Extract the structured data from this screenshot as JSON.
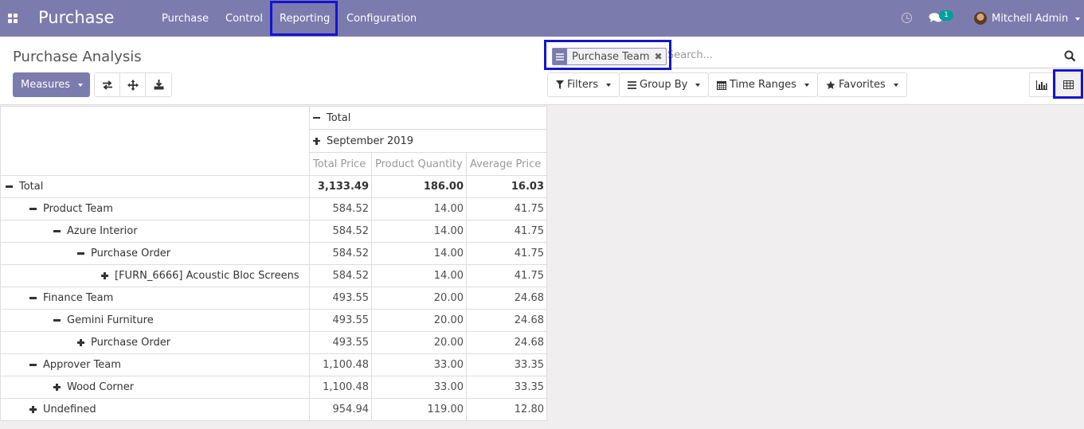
{
  "navbar": {
    "brand": "Purchase",
    "menu": [
      "Purchase",
      "Control",
      "Reporting",
      "Configuration"
    ],
    "notification_count": "1",
    "user": "Mitchell Admin"
  },
  "control_panel": {
    "breadcrumb": "Purchase Analysis",
    "measures_label": "Measures",
    "search": {
      "facet_label": "Purchase Team",
      "placeholder": "Search..."
    },
    "filters": [
      "Filters",
      "Group By",
      "Time Ranges",
      "Favorites"
    ]
  },
  "pivot": {
    "col_total": "Total",
    "col_group": "September 2019",
    "measures": [
      "Total Price",
      "Product Quantity",
      "Average Price"
    ],
    "rows": [
      {
        "label": "Total",
        "level": 0,
        "expanded": true,
        "values": [
          "3,133.49",
          "186.00",
          "16.03"
        ],
        "bold": true
      },
      {
        "label": "Product Team",
        "level": 1,
        "expanded": true,
        "values": [
          "584.52",
          "14.00",
          "41.75"
        ]
      },
      {
        "label": "Azure Interior",
        "level": 2,
        "expanded": true,
        "values": [
          "584.52",
          "14.00",
          "41.75"
        ]
      },
      {
        "label": "Purchase Order",
        "level": 3,
        "expanded": true,
        "values": [
          "584.52",
          "14.00",
          "41.75"
        ]
      },
      {
        "label": "[FURN_6666] Acoustic Bloc Screens",
        "level": 4,
        "expanded": false,
        "values": [
          "584.52",
          "14.00",
          "41.75"
        ]
      },
      {
        "label": "Finance Team",
        "level": 1,
        "expanded": true,
        "values": [
          "493.55",
          "20.00",
          "24.68"
        ]
      },
      {
        "label": "Gemini Furniture",
        "level": 2,
        "expanded": true,
        "values": [
          "493.55",
          "20.00",
          "24.68"
        ]
      },
      {
        "label": "Purchase Order",
        "level": 3,
        "expanded": false,
        "values": [
          "493.55",
          "20.00",
          "24.68"
        ]
      },
      {
        "label": "Approver Team",
        "level": 1,
        "expanded": true,
        "values": [
          "1,100.48",
          "33.00",
          "33.35"
        ]
      },
      {
        "label": "Wood Corner",
        "level": 2,
        "expanded": false,
        "values": [
          "1,100.48",
          "33.00",
          "33.35"
        ]
      },
      {
        "label": "Undefined",
        "level": 1,
        "expanded": false,
        "values": [
          "954.94",
          "119.00",
          "12.80"
        ]
      }
    ]
  },
  "colors": {
    "navbar": "#7c7bad",
    "highlight_box": "#1414d2",
    "badge": "#00a09d"
  }
}
